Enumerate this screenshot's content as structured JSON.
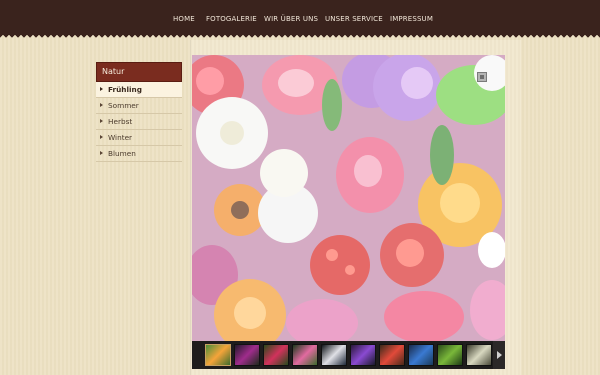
{
  "nav": {
    "items": [
      "HOME",
      "FOTOGALERIE",
      "WIR ÜBER UNS",
      "UNSER SERVICE",
      "IMPRESSUM"
    ]
  },
  "sidebar": {
    "heading": "Natur",
    "items": [
      {
        "label": "Frühling",
        "active": true
      },
      {
        "label": "Sommer",
        "active": false
      },
      {
        "label": "Herbst",
        "active": false
      },
      {
        "label": "Winter",
        "active": false
      },
      {
        "label": "Blumen",
        "active": false
      }
    ]
  },
  "gallery": {
    "main_image": "flower-bouquet-photo",
    "thumbnail_count": 10,
    "selected_thumbnail": 0
  },
  "colors": {
    "topbar": "#3a231d",
    "sidebar_heading": "#7a2c1f",
    "page_background": "#ede1c2"
  }
}
